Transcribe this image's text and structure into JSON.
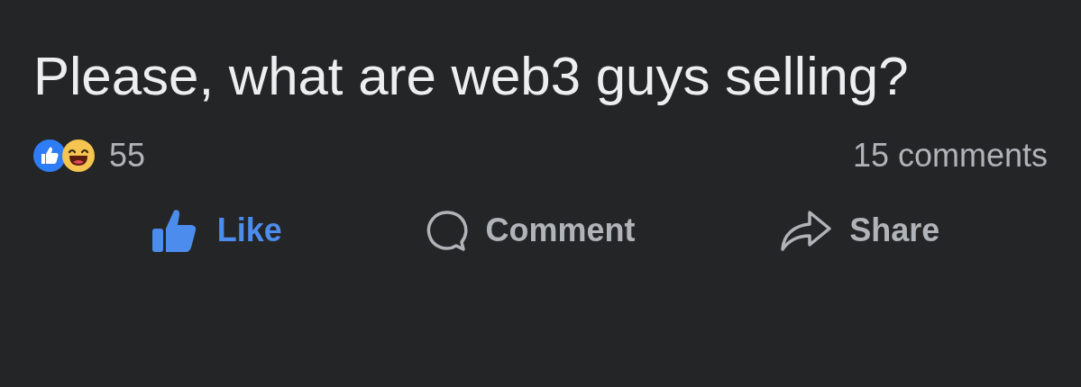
{
  "post": {
    "text": "Please, what are web3 guys selling?"
  },
  "reactions": {
    "count": "55",
    "comments": "15 comments"
  },
  "actions": [
    {
      "kind": "like",
      "label": "Like",
      "selected": true
    },
    {
      "kind": "comment",
      "label": "Comment",
      "selected": false
    },
    {
      "kind": "share",
      "label": "Share",
      "selected": false
    }
  ]
}
